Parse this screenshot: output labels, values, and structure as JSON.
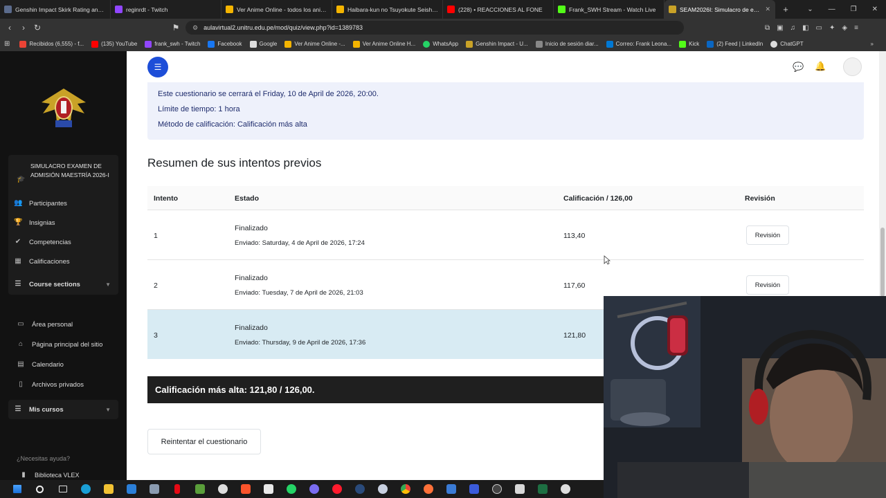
{
  "browser": {
    "tabs": [
      {
        "label": "Genshin Impact Skirk Rating and Be",
        "color": "#5b6b8c"
      },
      {
        "label": "reginrdt - Twitch",
        "color": "#9146ff"
      },
      {
        "label": "Ver Anime Online - todos los anime",
        "color": "#f4b400"
      },
      {
        "label": "Haibara-kun no Tsuyokute Seishun",
        "color": "#f4b400"
      },
      {
        "label": "(228) • REACCIONES AL FONE",
        "color": "#ff0000"
      },
      {
        "label": "Frank_SWH Stream - Watch Live",
        "color": "#53fc18"
      },
      {
        "label": "SEAM2026I: Simulacro de exam",
        "color": "#c9a227"
      }
    ],
    "url": "aulavirtual2.unitru.edu.pe/mod/quiz/view.php?id=1389783",
    "bookmarks": [
      {
        "label": "Recibidos (6,555) - f...",
        "color": "#ea4335"
      },
      {
        "label": "(135) YouTube",
        "color": "#ff0000"
      },
      {
        "label": "frank_swh - Twitch",
        "color": "#9146ff"
      },
      {
        "label": "Facebook",
        "color": "#1877f2"
      },
      {
        "label": "Google",
        "color": "#dddddd"
      },
      {
        "label": "Ver Anime Online -...",
        "color": "#f4b400"
      },
      {
        "label": "Ver Anime Online H...",
        "color": "#f4b400"
      },
      {
        "label": "WhatsApp",
        "color": "#25d366"
      },
      {
        "label": "Genshin Impact - U...",
        "color": "#c9a227"
      },
      {
        "label": "Inicio de sesión diar...",
        "color": "#888888"
      },
      {
        "label": "Correo: Frank Leona...",
        "color": "#0078d4"
      },
      {
        "label": "Kick",
        "color": "#53fc18"
      },
      {
        "label": "(2) Feed | LinkedIn",
        "color": "#0a66c2"
      },
      {
        "label": "ChatGPT",
        "color": "#dddddd"
      }
    ]
  },
  "sidebar": {
    "course_title": "SIMULACRO EXAMEN DE ADMISIÓN MAESTRÍA 2026-I",
    "course_items": [
      "Participantes",
      "Insignias",
      "Competencias",
      "Calificaciones"
    ],
    "course_sections": "Course sections",
    "nav_items": [
      "Área personal",
      "Página principal del sitio",
      "Calendario",
      "Archivos privados"
    ],
    "my_courses": "Mis cursos",
    "help": "¿Necesitas ayuda?",
    "library": "Biblioteca VLEX"
  },
  "quiz": {
    "close_line": "Este cuestionario se cerrará el Friday, 10 de April de 2026, 20:00.",
    "time_limit": "Límite de tiempo: 1 hora",
    "grading_method": "Método de calificación: Calificación más alta",
    "summary_title": "Resumen de sus intentos previos",
    "columns": [
      "Intento",
      "Estado",
      "Calificación / 126,00",
      "Revisión"
    ],
    "attempts": [
      {
        "n": "1",
        "state": "Finalizado",
        "sent": "Enviado: Saturday, 4 de April de 2026, 17:24",
        "grade": "113,40",
        "review": "Revisión"
      },
      {
        "n": "2",
        "state": "Finalizado",
        "sent": "Enviado: Tuesday, 7 de April de 2026, 21:03",
        "grade": "117,60",
        "review": "Revisión"
      },
      {
        "n": "3",
        "state": "Finalizado",
        "sent": "Enviado: Thursday, 9 de April de 2026, 17:36",
        "grade": "121,80",
        "review": ""
      }
    ],
    "highest_grade": "Calificación más alta: 121,80 / 126,00.",
    "retry_label": "Reintentar el cuestionario"
  },
  "colors": {
    "accent": "#1d4ed8",
    "highlight_row": "#d8ebf3"
  }
}
